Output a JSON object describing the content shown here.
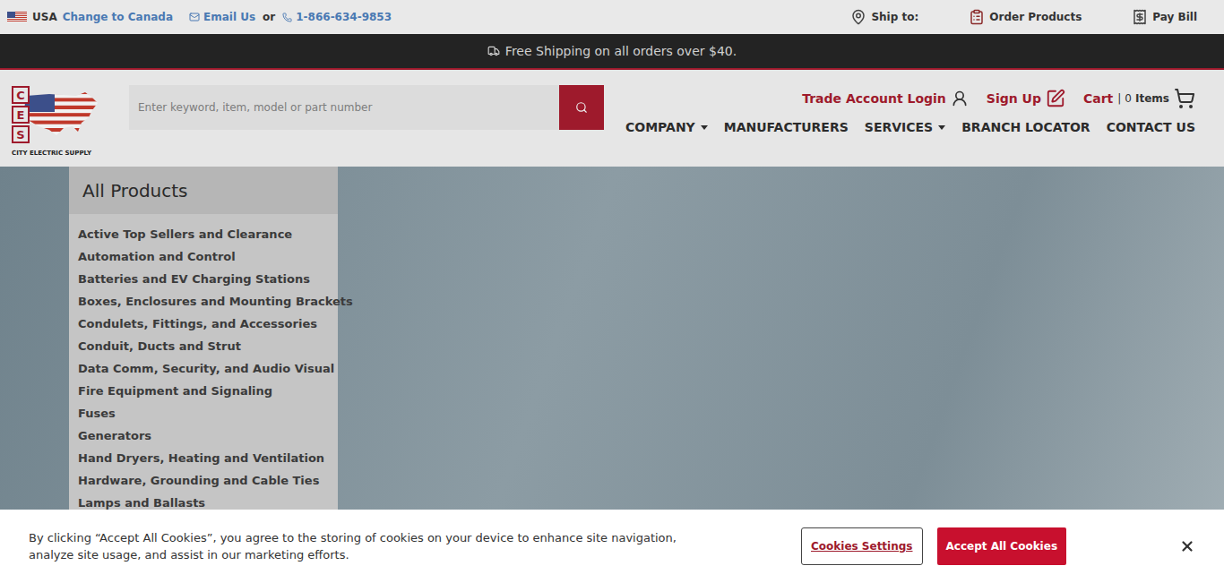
{
  "top_bar": {
    "country": "USA",
    "change_link": "Change to Canada",
    "email": "Email Us",
    "separator": "or",
    "phone": "1-866-634-9853",
    "ship_to": "Ship to:",
    "order": "Order Products",
    "pay": "Pay Bill"
  },
  "promo": {
    "text": "Free Shipping on all orders over $40."
  },
  "logo": {
    "letters": [
      "C",
      "E",
      "S"
    ],
    "name": "CITY ELECTRIC SUPPLY"
  },
  "search": {
    "placeholder": "Enter keyword, item, model or part number"
  },
  "account": {
    "login": "Trade Account Login",
    "signup": "Sign Up",
    "cart": "Cart",
    "divider": "|",
    "count": "0",
    "items": "Items"
  },
  "nav": [
    {
      "label": "COMPANY",
      "dropdown": true
    },
    {
      "label": "MANUFACTURERS",
      "dropdown": false
    },
    {
      "label": "SERVICES",
      "dropdown": true
    },
    {
      "label": "BRANCH LOCATOR",
      "dropdown": false
    },
    {
      "label": "CONTACT US",
      "dropdown": false
    }
  ],
  "categories": {
    "title": "All Products",
    "items": [
      "Active Top Sellers and Clearance",
      "Automation and Control",
      "Batteries and EV Charging Stations",
      "Boxes, Enclosures and Mounting Brackets",
      "Condulets, Fittings, and Accessories",
      "Conduit, Ducts and Strut",
      "Data Comm, Security, and Audio Visual",
      "Fire Equipment and Signaling",
      "Fuses",
      "Generators",
      "Hand Dryers, Heating and Ventilation",
      "Hardware, Grounding and Cable Ties",
      "Lamps and Ballasts"
    ]
  },
  "cookie": {
    "text": "By clicking “Accept All Cookies”, you agree to the storing of cookies on your device to enhance site navigation, analyze site usage, and assist in our marketing efforts.",
    "settings": "Cookies Settings",
    "accept": "Accept All Cookies"
  }
}
